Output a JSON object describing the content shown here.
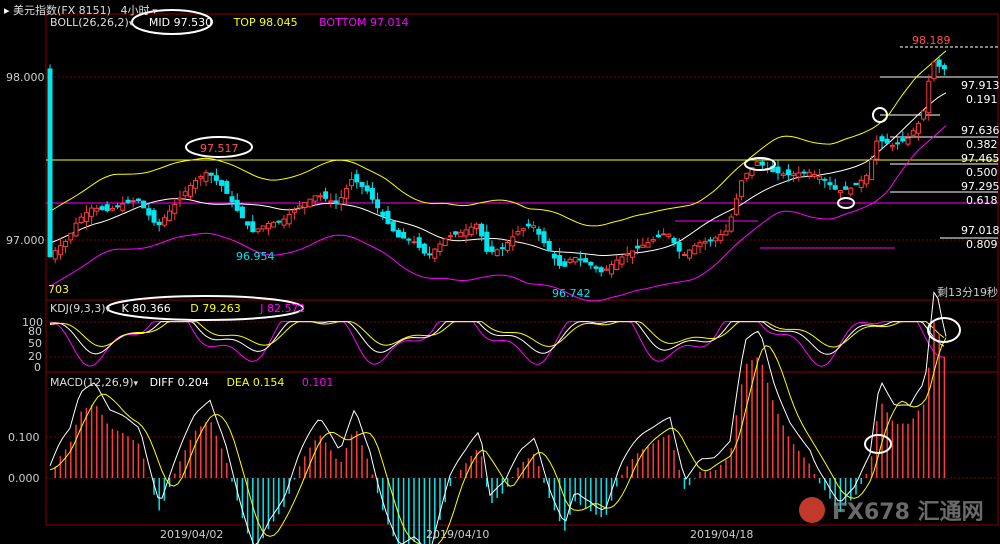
{
  "window": {
    "title": "美元指数(FX 8151)",
    "period": "4小时"
  },
  "boll": {
    "label": "BOLL(26,26,2)",
    "mid": "MID 97.530",
    "top": "TOP 98.045",
    "bottom": "BOTTOM 97.014"
  },
  "kdj": {
    "label": "KDJ(9,3,3)",
    "k": "K 80.366",
    "d": "D 79.263",
    "j": "J 82.572"
  },
  "macd": {
    "label": "MACD(12,26,9)",
    "diff": "DIFF 0.204",
    "dea": "DEA 0.154",
    "hist": "0.101"
  },
  "main_axis": {
    "ticks": [
      "98.000",
      "97.000"
    ]
  },
  "kdj_axis": {
    "ticks": [
      "100",
      "80",
      "50",
      "20",
      "0"
    ]
  },
  "macd_axis": {
    "ticks": [
      "0.100",
      "0.000"
    ]
  },
  "date_axis": {
    "ticks": [
      "2019/04/02",
      "2019/04/10",
      "2019/04/18"
    ]
  },
  "annotations": {
    "high": "98.189",
    "peak_left": "97.517",
    "low_1": "96.954",
    "low_2": "96.742",
    "small_left": "703",
    "countdown": "剩13分19秒"
  },
  "fib_levels": [
    {
      "value": "97.913",
      "label": "0.191"
    },
    {
      "value": "97.636",
      "label": "0.382"
    },
    {
      "value": "97.465",
      "label": "0.500"
    },
    {
      "value": "97.295",
      "label": "0.618"
    },
    {
      "value": "97.018",
      "label": "0.809"
    }
  ],
  "watermark": "FX678 汇通网",
  "colors": {
    "up": "#ff3b3b",
    "down": "#00e5ee",
    "yellow": "#ffff00",
    "magenta": "#ff00ff",
    "white": "#ffffff",
    "grid": "#7a0000"
  },
  "chart_data": {
    "type": "candlestick",
    "panels": [
      "BOLL",
      "KDJ",
      "MACD"
    ],
    "price": {
      "high": 98.189,
      "low": 96.742,
      "peak_left": 97.517,
      "low_left": 96.954
    },
    "boll": {
      "mid": 97.53,
      "top": 98.045,
      "bottom": 97.014
    },
    "kdj": {
      "k": 80.366,
      "d": 79.263,
      "j": 82.572
    },
    "macd": {
      "diff": 0.204,
      "dea": 0.154,
      "histogram": 0.101
    },
    "dates": [
      "2019/04/02",
      "2019/04/10",
      "2019/04/18"
    ]
  }
}
